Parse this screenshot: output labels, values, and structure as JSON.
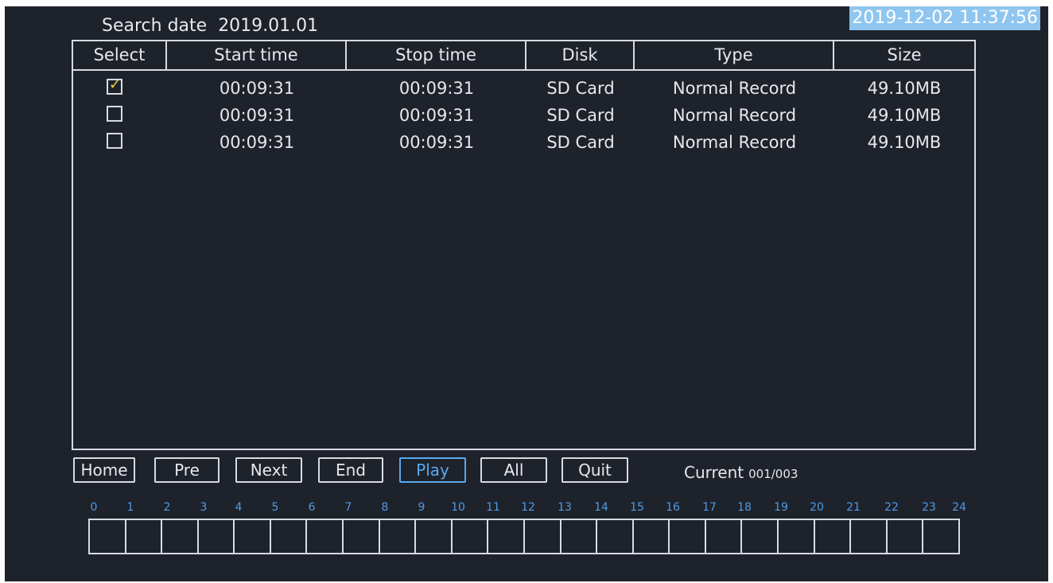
{
  "search": {
    "label": "Search date",
    "date": "2019.01.01"
  },
  "clock": {
    "datetime": "2019-12-02  11:37:56"
  },
  "table": {
    "headers": {
      "select": "Select",
      "start": "Start time",
      "stop": "Stop time",
      "disk": "Disk",
      "type": "Type",
      "size": "Size"
    },
    "rows": [
      {
        "checked": true,
        "checkmark": "✓",
        "start": "00:09:31",
        "stop": "00:09:31",
        "disk": "SD Card",
        "type": "Normal Record",
        "size": "49.10MB"
      },
      {
        "checked": false,
        "checkmark": "",
        "start": "00:09:31",
        "stop": "00:09:31",
        "disk": "SD Card",
        "type": "Normal Record",
        "size": "49.10MB"
      },
      {
        "checked": false,
        "checkmark": "",
        "start": "00:09:31",
        "stop": "00:09:31",
        "disk": "SD Card",
        "type": "Normal Record",
        "size": "49.10MB"
      }
    ]
  },
  "buttons": {
    "home": "Home",
    "pre": "Pre",
    "next": "Next",
    "end": "End",
    "play": "Play",
    "all": "All",
    "quit": "Quit"
  },
  "status": {
    "current_label": "Current",
    "current_value": "001/003"
  },
  "timeline": {
    "hours": [
      "0",
      "1",
      "2",
      "3",
      "4",
      "5",
      "6",
      "7",
      "8",
      "9",
      "10",
      "11",
      "12",
      "13",
      "14",
      "15",
      "16",
      "17",
      "18",
      "19",
      "20",
      "21",
      "22",
      "23",
      "24"
    ]
  },
  "colors": {
    "background": "#1e222b",
    "text": "#e6e8ec",
    "accent_active": "#58a9f0",
    "clock_highlight": "#8fc6ef",
    "checkmark": "#f4d23c"
  }
}
